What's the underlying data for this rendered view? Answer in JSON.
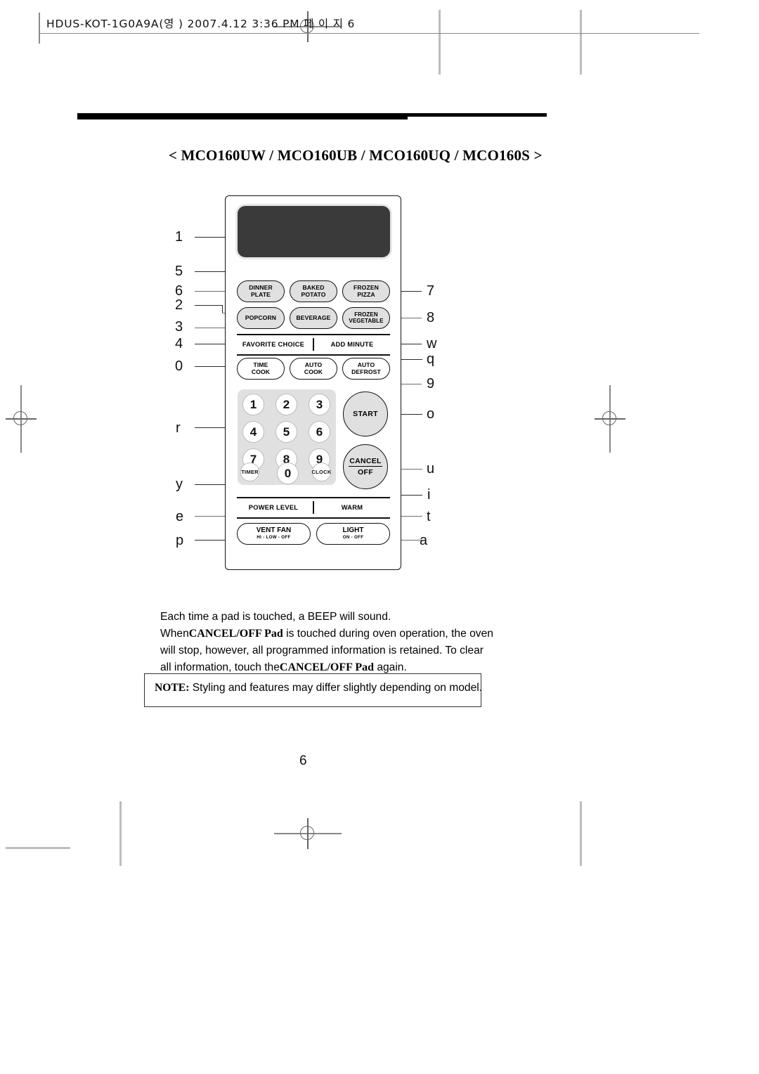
{
  "print_header": {
    "text": "HDUS-KOT-1G0A9A(영 )  2007.4.12 3:36 PM  페 이 지 6"
  },
  "title": "< MCO160UW / MCO160UB / MCO160UQ / MCO160S >",
  "control_panel": {
    "display_name": "display-window",
    "sensor_buttons_row1": [
      {
        "line1": "DINNER",
        "line2": "PLATE"
      },
      {
        "line1": "BAKED",
        "line2": "POTATO"
      },
      {
        "line1": "FROZEN",
        "line2": "PIZZA"
      }
    ],
    "sensor_buttons_row2": [
      {
        "line1": "POPCORN",
        "line2": ""
      },
      {
        "line1": "BEVERAGE",
        "line2": ""
      },
      {
        "line1": "FROZEN",
        "line2": "VEGETABLE"
      }
    ],
    "strip_row_1": {
      "left": "FAVORITE CHOICE",
      "right": "ADD MINUTE"
    },
    "cook_buttons": [
      {
        "line1": "TIME",
        "line2": "COOK"
      },
      {
        "line1": "AUTO",
        "line2": "COOK"
      },
      {
        "line1": "AUTO",
        "line2": "DEFROST"
      }
    ],
    "keypad": {
      "digits": [
        "1",
        "2",
        "3",
        "4",
        "5",
        "6",
        "7",
        "8",
        "9"
      ],
      "zero": "0",
      "timer": "TIMER",
      "clock": "CLOCK"
    },
    "start_button": "START",
    "cancel_button": {
      "line1": "CANCEL",
      "line2": "OFF"
    },
    "strip_row_2": {
      "left": "POWER LEVEL",
      "right": "WARM"
    },
    "bottom_buttons": [
      {
        "label": "VENT FAN",
        "sub": "HI  -  LOW  -  OFF"
      },
      {
        "label": "LIGHT",
        "sub": "ON   -   OFF"
      }
    ],
    "callouts_left": [
      "1",
      "5",
      "6",
      "2",
      "3",
      "4",
      "0",
      "r",
      "y",
      "e",
      "p"
    ],
    "callouts_right": [
      "7",
      "8",
      "w",
      "q",
      "9",
      "o",
      "u",
      "i",
      "t",
      "a"
    ]
  },
  "body": {
    "line1": "Each time a pad is touched, a BEEP will sound.",
    "line2_pre": "When",
    "line2_bold": "CANCEL/OFF Pad",
    "line2_post": " is touched during oven operation, the oven",
    "line3": "will stop, however, all programmed information is retained. To clear",
    "line4_pre": "all information, touch the",
    "line4_bold": "CANCEL/OFF Pad",
    "line4_post": " again."
  },
  "note": {
    "label": "NOTE:",
    "text": " Styling and features may differ slightly depending on model."
  },
  "page_number": "6"
}
